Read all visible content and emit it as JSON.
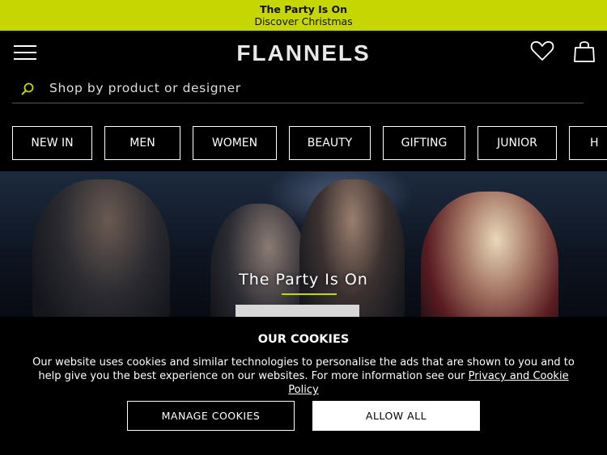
{
  "promo": {
    "title": "The Party Is On",
    "subtitle": "Discover Christmas",
    "color": "#c5d600"
  },
  "header": {
    "logo": "FLANNELS",
    "menu_icon": "hamburger-menu-icon",
    "wishlist_icon": "heart-icon",
    "bag_icon": "shopping-bag-icon"
  },
  "search": {
    "placeholder": "Shop by product or designer",
    "icon": "search-icon"
  },
  "nav": {
    "items": [
      {
        "label": "NEW IN"
      },
      {
        "label": "MEN"
      },
      {
        "label": "WOMEN"
      },
      {
        "label": "BEAUTY"
      },
      {
        "label": "GIFTING"
      },
      {
        "label": "JUNIOR"
      },
      {
        "label": "H"
      }
    ]
  },
  "hero": {
    "title": "The Party Is On",
    "accent_color": "#c5d600"
  },
  "cookies": {
    "title": "OUR COOKIES",
    "text": "Our website uses cookies and similar technologies to personalise the ads that are shown to you and to help give you the best experience on our websites. For more information see our ",
    "link": "Privacy and Cookie Policy",
    "manage_label": "MANAGE COOKIES",
    "allow_label": "ALLOW ALL"
  }
}
